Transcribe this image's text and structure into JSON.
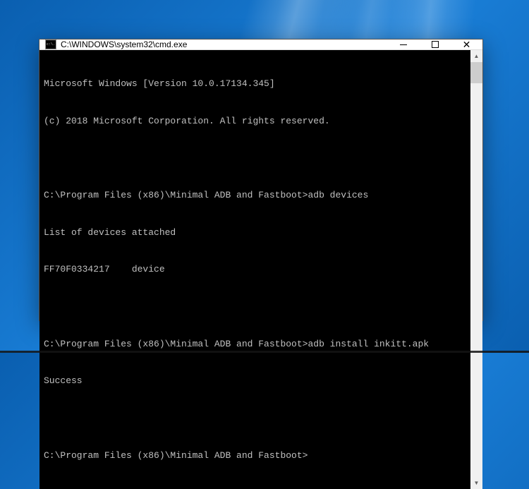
{
  "window": {
    "title": "C:\\WINDOWS\\system32\\cmd.exe"
  },
  "terminal": {
    "lines": [
      "Microsoft Windows [Version 10.0.17134.345]",
      "(c) 2018 Microsoft Corporation. All rights reserved.",
      "",
      "C:\\Program Files (x86)\\Minimal ADB and Fastboot>adb devices",
      "List of devices attached",
      "FF70F0334217    device",
      "",
      "C:\\Program Files (x86)\\Minimal ADB and Fastboot>adb install inkitt.apk",
      "Success",
      "",
      "C:\\Program Files (x86)\\Minimal ADB and Fastboot>"
    ]
  },
  "controls": {
    "minimize": "minimize",
    "maximize": "maximize",
    "close": "close"
  }
}
